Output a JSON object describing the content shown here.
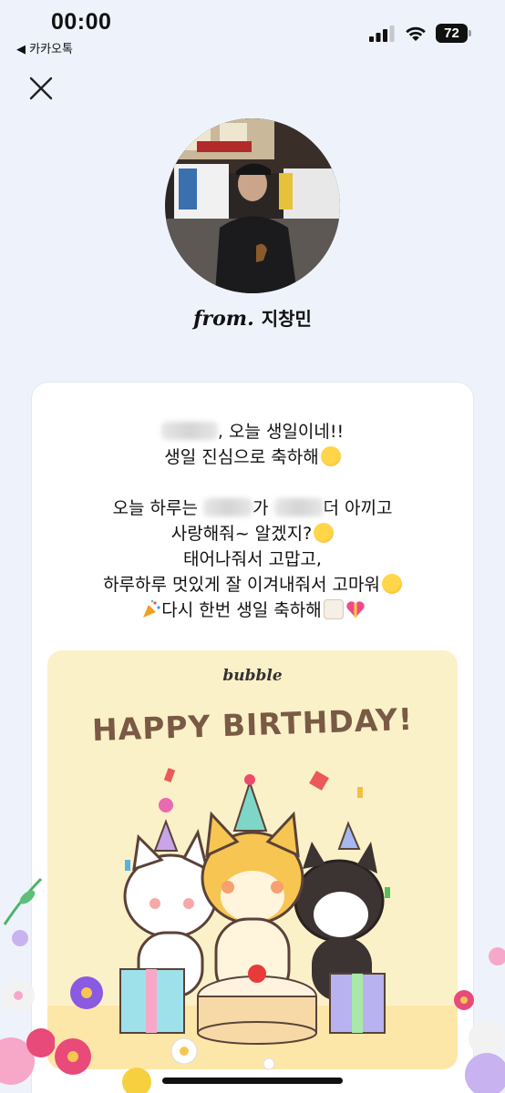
{
  "status_bar": {
    "time": "00:00",
    "back_app": "◀ 카카오톡",
    "battery": "72"
  },
  "profile": {
    "from_label": "from.",
    "name": "지창민"
  },
  "message": {
    "line1_suffix": ", 오늘 생일이네!!",
    "line2": "생일 진심으로 축하해",
    "line3_a": "오늘 하루는 ",
    "line3_b": "가 ",
    "line3_c": "더 아끼고",
    "line4": "사랑해줘~ 알겠지?",
    "line5": "태어나줘서 고맙고,",
    "line6": "하루하루 멋있게 잘 이겨내줘서 고마워",
    "line7": "다시 한번 생일 축하해"
  },
  "birthday_card": {
    "brand": "bubble",
    "title": "HAPPY BIRTHDAY!"
  },
  "icons": [
    "close-icon",
    "signal-icon",
    "wifi-icon",
    "battery-icon"
  ],
  "colors": {
    "background": "#eef3fb",
    "card": "#ffffff",
    "bday_bg": "#fbf1c9",
    "title_brown": "#7a5a44"
  }
}
